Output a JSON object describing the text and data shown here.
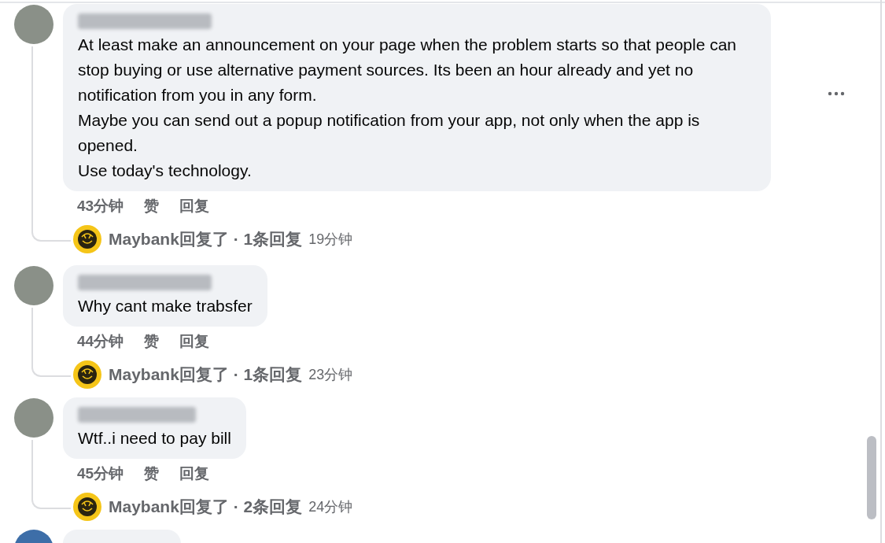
{
  "comments": [
    {
      "paragraphs": [
        "At least make an announcement on your page when the problem starts so that people can stop buying or use alternative payment sources. Its been an hour already and yet no notification from you in any form.",
        "Maybe you can send out a popup notification from your app, not only when the app is opened.",
        "Use today's technology."
      ],
      "more": true,
      "time": "43分钟",
      "like": "赞",
      "reply": "回复",
      "replies": {
        "summary": "Maybank回复了 · 1条回复",
        "time": "19分钟"
      }
    },
    {
      "paragraphs": [
        "Why cant make trabsfer"
      ],
      "more": false,
      "time": "44分钟",
      "like": "赞",
      "reply": "回复",
      "replies": {
        "summary": "Maybank回复了 · 1条回复",
        "time": "23分钟"
      }
    },
    {
      "paragraphs": [
        "Wtf..i need to pay bill"
      ],
      "more": false,
      "time": "45分钟",
      "like": "赞",
      "reply": "回复",
      "replies": {
        "summary": "Maybank回复了 · 2条回复",
        "time": "24分钟"
      }
    }
  ],
  "next_comment": {
    "visible": true
  }
}
